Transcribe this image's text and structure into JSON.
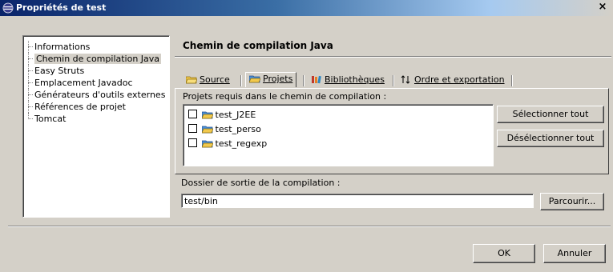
{
  "window": {
    "title": "Propriétés de test",
    "close_label": "×"
  },
  "tree": {
    "items": [
      {
        "label": "Informations",
        "selected": false
      },
      {
        "label": "Chemin de compilation Java",
        "selected": true
      },
      {
        "label": "Easy Struts",
        "selected": false
      },
      {
        "label": "Emplacement Javadoc",
        "selected": false
      },
      {
        "label": "Générateurs d'outils externes",
        "selected": false
      },
      {
        "label": "Références de projet",
        "selected": false
      },
      {
        "label": "Tomcat",
        "selected": false
      }
    ]
  },
  "page": {
    "title": "Chemin de compilation Java"
  },
  "tabs": [
    {
      "label": "Source",
      "icon": "source-folder-icon",
      "active": false
    },
    {
      "label": "Projets",
      "icon": "projects-folder-icon",
      "active": true
    },
    {
      "label": "Bibliothèques",
      "icon": "library-icon",
      "active": false
    },
    {
      "label": "Ordre et exportation",
      "icon": "sort-arrows-icon",
      "active": false
    }
  ],
  "projects": {
    "label": "Projets requis dans le chemin de compilation :",
    "items": [
      {
        "label": "test_J2EE",
        "checked": false
      },
      {
        "label": "test_perso",
        "checked": false
      },
      {
        "label": "test_regexp",
        "checked": false
      }
    ],
    "select_all": "Sélectionner tout",
    "deselect_all": "Désélectionner tout"
  },
  "output": {
    "label": "Dossier de sortie de la compilation :",
    "value": "test/bin",
    "browse": "Parcourir..."
  },
  "buttons": {
    "ok": "OK",
    "cancel": "Annuler"
  },
  "colors": {
    "title_bar_start": "#0a246a",
    "title_bar_end": "#a6caf0",
    "dialog_background": "#d4d0c8",
    "folder_yellow": "#f2c94c"
  }
}
